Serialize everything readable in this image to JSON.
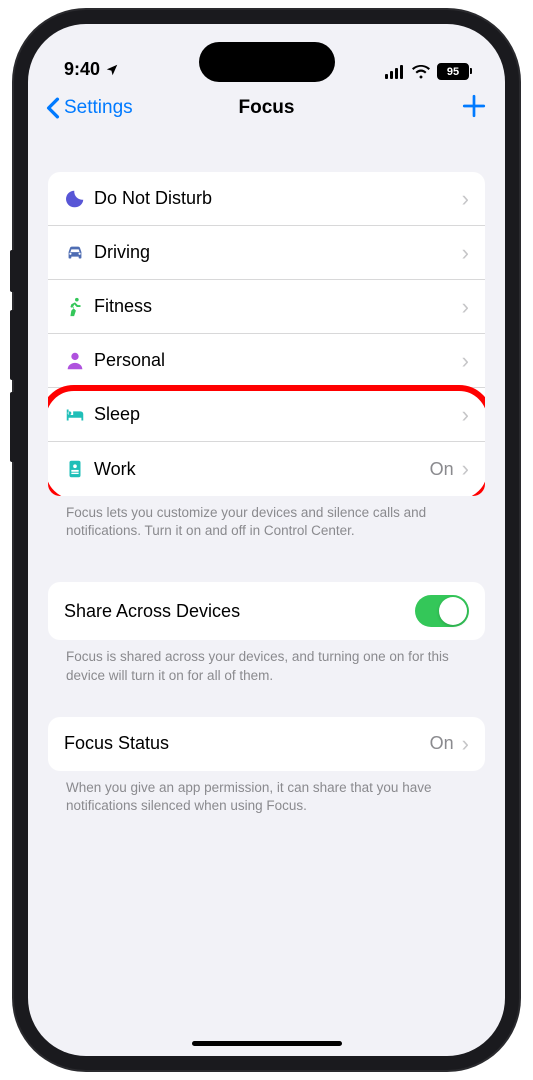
{
  "statusBar": {
    "time": "9:40",
    "battery": "95"
  },
  "nav": {
    "back": "Settings",
    "title": "Focus"
  },
  "focusModes": [
    {
      "label": "Do Not Disturb"
    },
    {
      "label": "Driving"
    },
    {
      "label": "Fitness"
    },
    {
      "label": "Personal"
    },
    {
      "label": "Sleep"
    },
    {
      "label": "Work",
      "value": "On"
    }
  ],
  "footer1": "Focus lets you customize your devices and silence calls and notifications. Turn it on and off in Control Center.",
  "shareRow": {
    "label": "Share Across Devices",
    "enabled": true
  },
  "footer2": "Focus is shared across your devices, and turning one on for this device will turn it on for all of them.",
  "statusRow": {
    "label": "Focus Status",
    "value": "On"
  },
  "footer3": "When you give an app permission, it can share that you have notifications silenced when using Focus."
}
